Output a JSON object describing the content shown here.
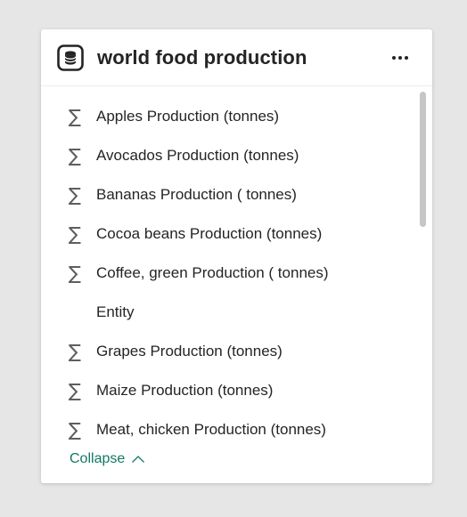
{
  "table": {
    "title": "world food production",
    "icon": "database-icon",
    "more_icon": "more-options-icon"
  },
  "fields": [
    {
      "label": "Apples Production (tonnes)",
      "icon": "sigma"
    },
    {
      "label": "Avocados Production (tonnes)",
      "icon": "sigma"
    },
    {
      "label": "Bananas Production ( tonnes)",
      "icon": "sigma"
    },
    {
      "label": "Cocoa beans Production (tonnes)",
      "icon": "sigma"
    },
    {
      "label": "Coffee, green Production ( tonnes)",
      "icon": "sigma"
    },
    {
      "label": "Entity",
      "icon": ""
    },
    {
      "label": "Grapes Production (tonnes)",
      "icon": "sigma"
    },
    {
      "label": "Maize Production (tonnes)",
      "icon": "sigma"
    },
    {
      "label": "Meat, chicken Production (tonnes)",
      "icon": "sigma"
    }
  ],
  "collapse": {
    "label": "Collapse",
    "icon": "chevron-up-icon"
  },
  "colors": {
    "accent": "#117865",
    "text": "#252423",
    "icon": "#605e5c",
    "background": "#e6e6e6",
    "card": "#ffffff"
  }
}
